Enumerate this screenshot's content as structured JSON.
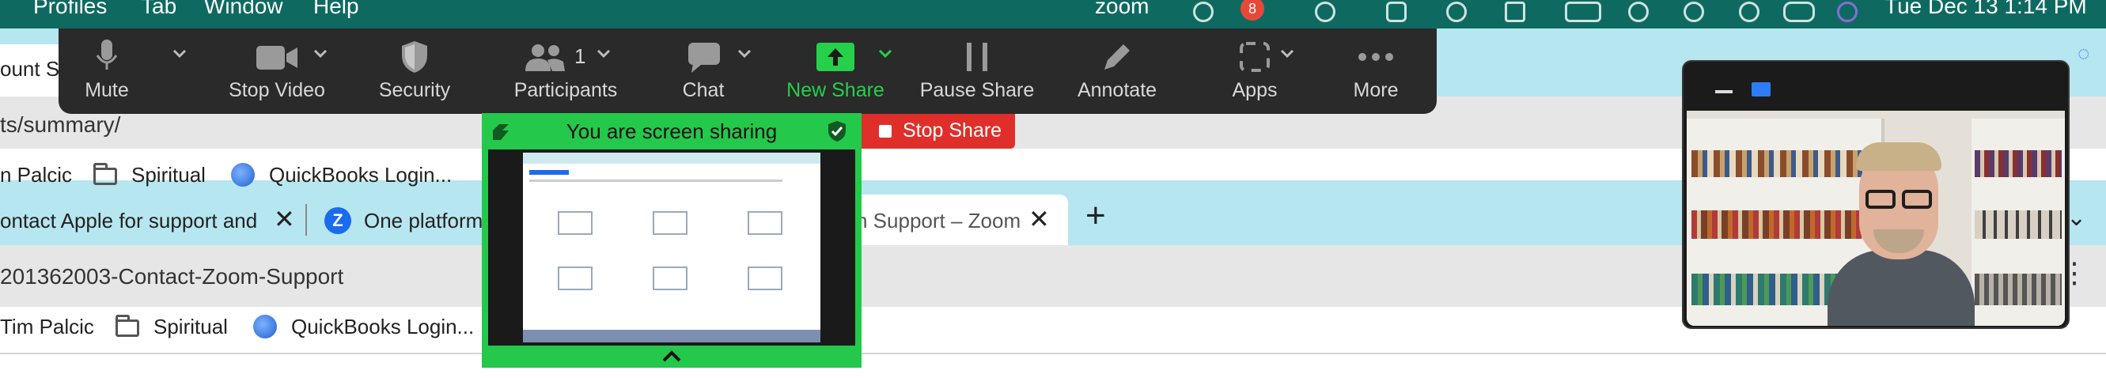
{
  "menubar": {
    "items": [
      "Profiles",
      "Tab",
      "Window",
      "Help"
    ],
    "app_label": "zoom",
    "notification_count": "8",
    "clock": "Tue Dec 13  1:14 PM"
  },
  "browser_top": {
    "tab_partial": "ount Su",
    "url_partial": "ts/summary/",
    "bookmarks": [
      "n Palcic",
      "Spiritual",
      "QuickBooks Login..."
    ]
  },
  "browser_bottom": {
    "tabs": [
      {
        "label": "ontact Apple for support and"
      },
      {
        "label": "One platform"
      },
      {
        "label": "n Support – Zoom"
      }
    ],
    "new_tab_symbol": "+",
    "url": "201362003-Contact-Zoom-Support",
    "bookmarks": [
      "Tim Palcic",
      "Spiritual",
      "QuickBooks Login..."
    ]
  },
  "toolbar": {
    "buttons": [
      {
        "label": "Mute",
        "icon": "microphone-icon"
      },
      {
        "label": "Stop Video",
        "icon": "video-camera-icon"
      },
      {
        "label": "Security",
        "icon": "shield-icon"
      },
      {
        "label": "Participants",
        "icon": "participants-icon",
        "count": "1"
      },
      {
        "label": "Chat",
        "icon": "chat-bubble-icon"
      },
      {
        "label": "New Share",
        "icon": "share-arrow-icon"
      },
      {
        "label": "Pause Share",
        "icon": "pause-icon"
      },
      {
        "label": "Annotate",
        "icon": "pencil-icon"
      },
      {
        "label": "Apps",
        "icon": "apps-icon"
      },
      {
        "label": "More",
        "icon": "ellipsis-icon"
      }
    ],
    "accent": "#25d14a"
  },
  "sharing": {
    "status": "You are screen sharing",
    "stop_label": "Stop Share",
    "panel_color": "#24c84a",
    "stop_color": "#e02f2a"
  }
}
